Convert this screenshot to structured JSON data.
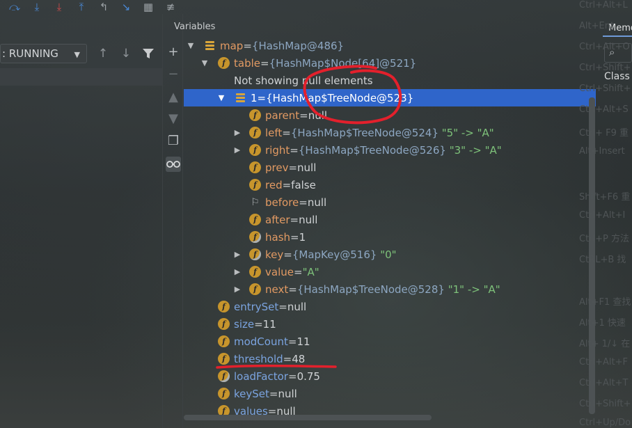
{
  "toolbar": {
    "icons": [
      "step-over-icon",
      "step-into-icon",
      "force-step-into-icon",
      "step-out-icon",
      "drop-frame-icon",
      "run-to-cursor-icon",
      "evaluate-icon",
      "trace-icon"
    ]
  },
  "frames": {
    "thread_status": ": RUNNING"
  },
  "variables": {
    "header": "Variables",
    "not_showing": "Not showing null elements",
    "rows": [
      {
        "name": "map",
        "eq": " = ",
        "value": "{HashMap@486}"
      },
      {
        "name": "table",
        "eq": " = ",
        "value": "{HashMap$Node[64]@521}"
      },
      {
        "name": "1",
        "eq": " = ",
        "value": "{HashMap$TreeNode@523}"
      },
      {
        "name": "parent",
        "eq": " = ",
        "value": "null"
      },
      {
        "name": "left",
        "eq": " = ",
        "value": "{HashMap$TreeNode@524}",
        "str": "\"5\" -> \"A\""
      },
      {
        "name": "right",
        "eq": " = ",
        "value": "{HashMap$TreeNode@526}",
        "str": "\"3\" -> \"A\""
      },
      {
        "name": "prev",
        "eq": " = ",
        "value": "null"
      },
      {
        "name": "red",
        "eq": " = ",
        "value": "false"
      },
      {
        "name": "before",
        "eq": " = ",
        "value": "null"
      },
      {
        "name": "after",
        "eq": " = ",
        "value": "null"
      },
      {
        "name": "hash",
        "eq": " = ",
        "value": "1"
      },
      {
        "name": "key",
        "eq": " = ",
        "value": "{MapKey@516}",
        "str": "\"0\""
      },
      {
        "name": "value",
        "eq": " = ",
        "value": "",
        "str": "\"A\""
      },
      {
        "name": "next",
        "eq": " = ",
        "value": "{HashMap$TreeNode@528}",
        "str": "\"1\" -> \"A\""
      },
      {
        "name": "entrySet",
        "eq": " = ",
        "value": "null"
      },
      {
        "name": "size",
        "eq": " = ",
        "value": "11"
      },
      {
        "name": "modCount",
        "eq": " = ",
        "value": "11"
      },
      {
        "name": "threshold",
        "eq": " = ",
        "value": "48"
      },
      {
        "name": "loadFactor",
        "eq": " = ",
        "value": "0.75"
      },
      {
        "name": "keySet",
        "eq": " = ",
        "value": "null"
      },
      {
        "name": "values",
        "eq": " = ",
        "value": "null"
      }
    ]
  },
  "memory": {
    "tab": "Memo",
    "class_label": "Class"
  },
  "shortcuts": [
    "Ctrl+Alt+L",
    "Alt+Ent",
    "Ctrl+Alt+O",
    "Ctrl+Shift+",
    "Ctrl+Shift+",
    "Ctrl+Alt+S",
    "Ctrl+ F9 重",
    "Alt+Insert",
    "Shift+F6 重",
    "Ctrl+Alt+I",
    "Ctrl+P 方法",
    "CtRL+B 找",
    "Alt+F1 查找",
    "Alt+1 快速",
    "Alt+ 1/↓ 在",
    "Ctrl+Alt+F",
    "Ctrl+Alt+T",
    "Ctrl+Shift+",
    "Ctrl+Up/Do"
  ]
}
